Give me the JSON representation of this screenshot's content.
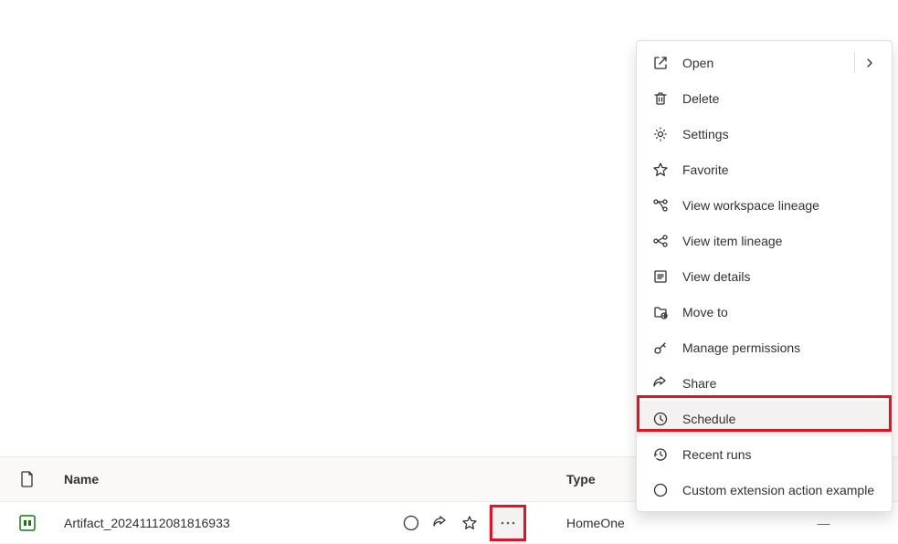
{
  "table": {
    "headers": {
      "name": "Name",
      "type": "Type"
    },
    "row": {
      "name": "Artifact_20241112081816933",
      "type": "HomeOne",
      "owner": "—"
    }
  },
  "menu": {
    "items": [
      {
        "id": "open",
        "label": "Open",
        "icon": "open-icon",
        "has_submenu": true
      },
      {
        "id": "delete",
        "label": "Delete",
        "icon": "trash-icon"
      },
      {
        "id": "settings",
        "label": "Settings",
        "icon": "gear-icon"
      },
      {
        "id": "favorite",
        "label": "Favorite",
        "icon": "star-icon"
      },
      {
        "id": "view-workspace-lineage",
        "label": "View workspace lineage",
        "icon": "lineage-icon"
      },
      {
        "id": "view-item-lineage",
        "label": "View item lineage",
        "icon": "item-lineage-icon"
      },
      {
        "id": "view-details",
        "label": "View details",
        "icon": "details-icon"
      },
      {
        "id": "move-to",
        "label": "Move to",
        "icon": "move-icon"
      },
      {
        "id": "manage-permissions",
        "label": "Manage permissions",
        "icon": "key-icon"
      },
      {
        "id": "share",
        "label": "Share",
        "icon": "share-icon"
      },
      {
        "id": "schedule",
        "label": "Schedule",
        "icon": "clock-icon",
        "highlighted": true
      },
      {
        "id": "recent-runs",
        "label": "Recent runs",
        "icon": "history-icon"
      },
      {
        "id": "custom-extension",
        "label": "Custom extension action example",
        "icon": "circle-icon"
      }
    ]
  }
}
